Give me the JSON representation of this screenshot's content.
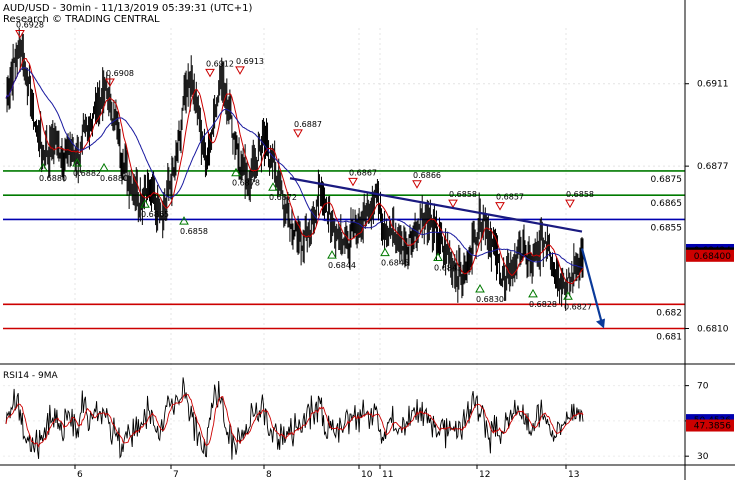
{
  "header": {
    "line1": "AUD/USD - 30min - 11/13/2019 05:39:31 (UTC+1)",
    "line2": "Research © TRADING CENTRAL"
  },
  "rsi_panel": {
    "title": "RSI14 - 9MA"
  },
  "colors": {
    "price": "#000000",
    "ma_fast": "#cc0000",
    "ma_slow": "#1a1aa0",
    "green_level": "#007a00",
    "blue_level": "#0000b0",
    "red_level": "#cc0000",
    "trend": "#1a1a80",
    "arrow": "#0a3a9a"
  },
  "chart_data": [
    {
      "type": "line",
      "title": "AUD/USD - 30min",
      "x_ticks": [
        "6",
        "7",
        "8",
        "10",
        "11",
        "12",
        "13"
      ],
      "y_ticks": [
        0.6911,
        0.6877,
        0.681
      ],
      "ylim": [
        0.6797,
        0.6934
      ],
      "horizontal_levels": [
        {
          "value": 0.6875,
          "label": "0.6875",
          "color": "green"
        },
        {
          "value": 0.6865,
          "label": "0.6865",
          "color": "green"
        },
        {
          "value": 0.6855,
          "label": "0.6855",
          "color": "blue"
        },
        {
          "value": 0.682,
          "label": "0.682",
          "color": "red"
        },
        {
          "value": 0.681,
          "label": "0.681",
          "color": "red"
        }
      ],
      "price_labels": [
        {
          "value": 0.68424,
          "label": "0.68424",
          "color": "blue"
        },
        {
          "value": 0.6841,
          "label": "0.6841",
          "color": "black"
        },
        {
          "value": 0.684,
          "label": "0.68400",
          "color": "red"
        }
      ],
      "peaks": [
        "0.6928",
        "0.6908",
        "0.6912",
        "0.6913",
        "0.6887",
        "0.6867",
        "0.6866",
        "0.6858",
        "0.6857",
        "0.6858"
      ],
      "troughs": [
        "0.6880",
        "0.6882",
        "0.6880",
        "0.6878",
        "0.6872",
        "0.6865",
        "0.6858",
        "0.6844",
        "0.6845",
        "0.6843",
        "0.6830",
        "0.6828",
        "0.6827"
      ],
      "close_series": [
        0.6905,
        0.6918,
        0.6928,
        0.6912,
        0.6895,
        0.6885,
        0.6883,
        0.6887,
        0.6882,
        0.6885,
        0.688,
        0.689,
        0.6897,
        0.6903,
        0.6908,
        0.6899,
        0.6885,
        0.6872,
        0.6868,
        0.6863,
        0.687,
        0.6862,
        0.6858,
        0.687,
        0.688,
        0.6905,
        0.6912,
        0.6898,
        0.6878,
        0.6895,
        0.6913,
        0.6905,
        0.689,
        0.6878,
        0.6873,
        0.688,
        0.6887,
        0.6882,
        0.6872,
        0.686,
        0.6852,
        0.6848,
        0.6845,
        0.6856,
        0.6867,
        0.686,
        0.6853,
        0.6848,
        0.6845,
        0.685,
        0.6855,
        0.6862,
        0.6866,
        0.6854,
        0.685,
        0.6845,
        0.6843,
        0.6848,
        0.6856,
        0.6858,
        0.685,
        0.6845,
        0.684,
        0.6835,
        0.683,
        0.684,
        0.6852,
        0.6857,
        0.6845,
        0.6837,
        0.6828,
        0.6835,
        0.6843,
        0.684,
        0.6836,
        0.6845,
        0.6848,
        0.6834,
        0.683,
        0.6827,
        0.6836,
        0.6841
      ]
    },
    {
      "type": "line",
      "title": "RSI14 - 9MA",
      "y_ticks": [
        70,
        50,
        30
      ],
      "ylim": [
        25,
        80
      ],
      "latest_values": [
        {
          "value": 50.4536,
          "label": "50.4536",
          "color": "blue"
        },
        {
          "value": 47.3856,
          "label": "47.3856",
          "color": "red"
        }
      ]
    }
  ]
}
